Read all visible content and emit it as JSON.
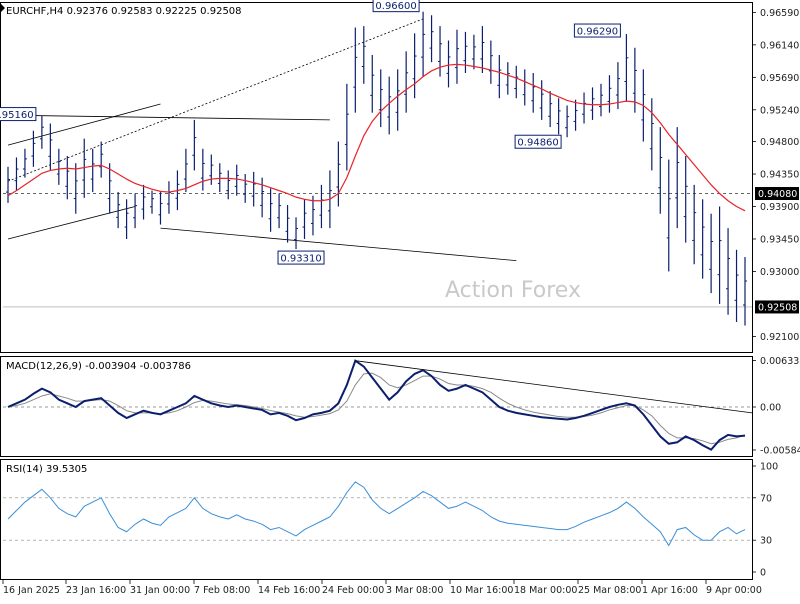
{
  "chart_data": {
    "type": "candlestick",
    "symbol_header": "EURCHF,H4  0.92376  0.92583  0.92225  0.92508",
    "watermark": "Action Forex",
    "colors": {
      "price": "#0b1f6e",
      "ma": "#e8232a",
      "macd": "#0b1f6e",
      "macd_signal": "#8a8a8a",
      "rsi": "#3a8fd9",
      "trendline": "#000000",
      "axis_text": "#222222"
    },
    "price_axis": {
      "range": [
        0.9187,
        0.9672
      ],
      "ticks": [
        "0.96590",
        "0.96140",
        "0.95690",
        "0.95240",
        "0.94800",
        "0.94350",
        "0.93900",
        "0.93450",
        "0.93000",
        "0.92100"
      ]
    },
    "current_price_label": "0.92508",
    "reference_level_label": "0.94080",
    "price_annotations": [
      {
        "text": "0.95160",
        "x": "23 Jan 08:00",
        "y": 0.9516
      },
      {
        "text": "0.93310",
        "x": "27 Feb 12:00",
        "y": 0.9331
      },
      {
        "text": "0.96600",
        "x": "10 Mar 08:00",
        "y": 0.966
      },
      {
        "text": "0.96290",
        "x": "1 Apr 08:00",
        "y": 0.9629
      },
      {
        "text": "0.94860",
        "x": "26 Mar 00:00",
        "y": 0.9486
      }
    ],
    "x_axis_labels": [
      "16 Jan 2025",
      "23 Jan 16:00",
      "31 Jan 00:00",
      "7 Feb 08:00",
      "14 Feb 16:00",
      "24 Feb 00:00",
      "3 Mar 08:00",
      "10 Mar 16:00",
      "18 Mar 00:00",
      "25 Mar 08:00",
      "1 Apr 16:00",
      "9 Apr 00:00"
    ],
    "price_series": [
      [
        0.9395,
        0.9445
      ],
      [
        0.9412,
        0.9458
      ],
      [
        0.943,
        0.947
      ],
      [
        0.9445,
        0.9495
      ],
      [
        0.947,
        0.9516
      ],
      [
        0.944,
        0.9505
      ],
      [
        0.942,
        0.947
      ],
      [
        0.94,
        0.946
      ],
      [
        0.938,
        0.945
      ],
      [
        0.9402,
        0.9484
      ],
      [
        0.941,
        0.947
      ],
      [
        0.943,
        0.948
      ],
      [
        0.938,
        0.945
      ],
      [
        0.936,
        0.941
      ],
      [
        0.9345,
        0.94
      ],
      [
        0.936,
        0.9408
      ],
      [
        0.9372,
        0.942
      ],
      [
        0.938,
        0.9412
      ],
      [
        0.9365,
        0.941
      ],
      [
        0.938,
        0.9425
      ],
      [
        0.9385,
        0.944
      ],
      [
        0.941,
        0.947
      ],
      [
        0.944,
        0.951
      ],
      [
        0.9412,
        0.947
      ],
      [
        0.942,
        0.9462
      ],
      [
        0.941,
        0.945
      ],
      [
        0.94,
        0.944
      ],
      [
        0.9405,
        0.9448
      ],
      [
        0.9395,
        0.9435
      ],
      [
        0.939,
        0.9438
      ],
      [
        0.9375,
        0.943
      ],
      [
        0.9355,
        0.9415
      ],
      [
        0.936,
        0.9408
      ],
      [
        0.934,
        0.9392
      ],
      [
        0.9331,
        0.9375
      ],
      [
        0.9345,
        0.94
      ],
      [
        0.935,
        0.9405
      ],
      [
        0.936,
        0.942
      ],
      [
        0.936,
        0.944
      ],
      [
        0.939,
        0.948
      ],
      [
        0.944,
        0.956
      ],
      [
        0.952,
        0.9638
      ],
      [
        0.956,
        0.964
      ],
      [
        0.952,
        0.96
      ],
      [
        0.95,
        0.958
      ],
      [
        0.949,
        0.957
      ],
      [
        0.9495,
        0.958
      ],
      [
        0.952,
        0.9605
      ],
      [
        0.954,
        0.963
      ],
      [
        0.957,
        0.966
      ],
      [
        0.959,
        0.9655
      ],
      [
        0.957,
        0.964
      ],
      [
        0.9555,
        0.962
      ],
      [
        0.956,
        0.9635
      ],
      [
        0.9575,
        0.9632
      ],
      [
        0.958,
        0.9628
      ],
      [
        0.9575,
        0.964
      ],
      [
        0.956,
        0.962
      ],
      [
        0.954,
        0.96
      ],
      [
        0.9545,
        0.959
      ],
      [
        0.954,
        0.9585
      ],
      [
        0.953,
        0.958
      ],
      [
        0.952,
        0.9575
      ],
      [
        0.951,
        0.9565
      ],
      [
        0.95,
        0.955
      ],
      [
        0.949,
        0.954
      ],
      [
        0.9486,
        0.953
      ],
      [
        0.9495,
        0.9538
      ],
      [
        0.9505,
        0.9548
      ],
      [
        0.951,
        0.9555
      ],
      [
        0.9515,
        0.956
      ],
      [
        0.952,
        0.9572
      ],
      [
        0.9525,
        0.959
      ],
      [
        0.9535,
        0.9629
      ],
      [
        0.952,
        0.961
      ],
      [
        0.948,
        0.958
      ],
      [
        0.944,
        0.954
      ],
      [
        0.938,
        0.95
      ],
      [
        0.93,
        0.9455
      ],
      [
        0.936,
        0.95
      ],
      [
        0.934,
        0.946
      ],
      [
        0.931,
        0.942
      ],
      [
        0.929,
        0.94
      ],
      [
        0.927,
        0.938
      ],
      [
        0.9255,
        0.939
      ],
      [
        0.924,
        0.936
      ],
      [
        0.923,
        0.933
      ],
      [
        0.9225,
        0.932
      ]
    ],
    "ma_series": [
      0.9405,
      0.9412,
      0.942,
      0.9428,
      0.9436,
      0.944,
      0.9442,
      0.9443,
      0.9442,
      0.9444,
      0.9446,
      0.9447,
      0.9442,
      0.9435,
      0.9428,
      0.9422,
      0.9418,
      0.9414,
      0.9411,
      0.941,
      0.9412,
      0.9415,
      0.942,
      0.9425,
      0.9428,
      0.9429,
      0.9429,
      0.9428,
      0.9426,
      0.9423,
      0.942,
      0.9416,
      0.9412,
      0.9408,
      0.9403,
      0.94,
      0.9398,
      0.9398,
      0.94,
      0.9408,
      0.943,
      0.946,
      0.9488,
      0.9508,
      0.9522,
      0.9533,
      0.9543,
      0.9552,
      0.956,
      0.957,
      0.9578,
      0.9583,
      0.9586,
      0.9587,
      0.9586,
      0.9584,
      0.9582,
      0.9579,
      0.9576,
      0.9572,
      0.9568,
      0.9563,
      0.9558,
      0.9553,
      0.9547,
      0.9542,
      0.9537,
      0.9534,
      0.9532,
      0.9531,
      0.9531,
      0.9532,
      0.9534,
      0.9536,
      0.9535,
      0.953,
      0.952,
      0.9506,
      0.949,
      0.9476,
      0.9462,
      0.9448,
      0.9434,
      0.942,
      0.9408,
      0.9398,
      0.939,
      0.9384
    ],
    "upper_trendline": {
      "from": {
        "x": 0,
        "y": 0.9425
      },
      "to": {
        "x": 49,
        "y": 0.965
      }
    },
    "resistance_line": {
      "from": {
        "x": 3,
        "y": 0.9516
      },
      "to": {
        "x": 38,
        "y": 0.951
      }
    },
    "support_line": {
      "from": {
        "x": 18,
        "y": 0.936
      },
      "to": {
        "x": 60,
        "y": 0.9315
      }
    },
    "channel_lower": {
      "from": {
        "x": 0,
        "y": 0.9345
      },
      "to": {
        "x": 15,
        "y": 0.939
      }
    },
    "channel_upper": {
      "from": {
        "x": 0,
        "y": 0.9475
      },
      "to": {
        "x": 18,
        "y": 0.9532
      }
    },
    "macd": {
      "label": "MACD(12,26,9) -0.003904 -0.003786",
      "ticks": [
        "0.006332",
        "0.00",
        "-0.005845"
      ],
      "range": [
        -0.0068,
        0.0068
      ],
      "macd_series": [
        0.0,
        0.0005,
        0.001,
        0.0018,
        0.0025,
        0.002,
        0.001,
        0.0005,
        0.0,
        0.0008,
        0.001,
        0.0012,
        0.0002,
        -0.0008,
        -0.0015,
        -0.001,
        -0.0005,
        -0.0008,
        -0.001,
        -0.0005,
        0.0,
        0.0005,
        0.0015,
        0.001,
        0.0005,
        0.0002,
        0.0,
        0.0002,
        0.0,
        -0.0002,
        -0.0004,
        -0.001,
        -0.0008,
        -0.0012,
        -0.0018,
        -0.0015,
        -0.001,
        -0.0008,
        -0.0005,
        0.0005,
        0.003,
        0.0063,
        0.0055,
        0.004,
        0.0025,
        0.001,
        0.002,
        0.0035,
        0.0045,
        0.005,
        0.0042,
        0.003,
        0.0022,
        0.0025,
        0.003,
        0.0025,
        0.002,
        0.001,
        0.0,
        -0.0005,
        -0.0008,
        -0.001,
        -0.0012,
        -0.0014,
        -0.0015,
        -0.0016,
        -0.0017,
        -0.0015,
        -0.0012,
        -0.0008,
        -0.0004,
        0.0,
        0.0003,
        0.0005,
        0.0002,
        -0.001,
        -0.0025,
        -0.004,
        -0.005,
        -0.0048,
        -0.004,
        -0.0045,
        -0.0052,
        -0.0058,
        -0.0045,
        -0.0038,
        -0.004,
        -0.0039
      ],
      "signal_series": [
        0.0,
        0.0002,
        0.0005,
        0.001,
        0.0015,
        0.0018,
        0.0015,
        0.0012,
        0.0008,
        0.0008,
        0.0009,
        0.001,
        0.0008,
        0.0002,
        -0.0005,
        -0.0008,
        -0.0008,
        -0.0008,
        -0.0009,
        -0.0008,
        -0.0005,
        0.0,
        0.0006,
        0.0009,
        0.0008,
        0.0006,
        0.0004,
        0.0003,
        0.0002,
        0.0,
        -0.0002,
        -0.0005,
        -0.0007,
        -0.0009,
        -0.0012,
        -0.0014,
        -0.0013,
        -0.0011,
        -0.0009,
        -0.0004,
        0.0008,
        0.003,
        0.0045,
        0.0046,
        0.004,
        0.003,
        0.0026,
        0.003,
        0.0036,
        0.0042,
        0.0042,
        0.0038,
        0.0032,
        0.003,
        0.003,
        0.0028,
        0.0025,
        0.002,
        0.0012,
        0.0005,
        0.0,
        -0.0004,
        -0.0007,
        -0.0009,
        -0.0011,
        -0.0013,
        -0.0014,
        -0.0014,
        -0.0013,
        -0.0011,
        -0.0008,
        -0.0004,
        -0.0001,
        0.0002,
        0.0002,
        -0.0004,
        -0.0012,
        -0.0025,
        -0.0036,
        -0.0042,
        -0.0042,
        -0.0043,
        -0.0046,
        -0.005,
        -0.0048,
        -0.0044,
        -0.0042,
        -0.0038
      ]
    },
    "rsi": {
      "label": "RSI(14) 39.5305",
      "ticks": [
        "100",
        "70",
        "30",
        "0"
      ],
      "range": [
        0,
        100
      ],
      "series": [
        50,
        58,
        66,
        72,
        78,
        70,
        60,
        55,
        52,
        62,
        66,
        70,
        55,
        42,
        38,
        45,
        50,
        46,
        44,
        52,
        56,
        60,
        70,
        60,
        55,
        52,
        50,
        54,
        50,
        48,
        45,
        40,
        42,
        38,
        34,
        40,
        44,
        48,
        52,
        62,
        75,
        85,
        80,
        68,
        60,
        55,
        60,
        65,
        70,
        76,
        72,
        66,
        60,
        62,
        66,
        62,
        58,
        52,
        48,
        46,
        45,
        44,
        43,
        42,
        41,
        40,
        40,
        43,
        47,
        50,
        53,
        56,
        60,
        66,
        60,
        52,
        45,
        38,
        25,
        40,
        42,
        35,
        30,
        30,
        38,
        42,
        36,
        40
      ]
    }
  }
}
